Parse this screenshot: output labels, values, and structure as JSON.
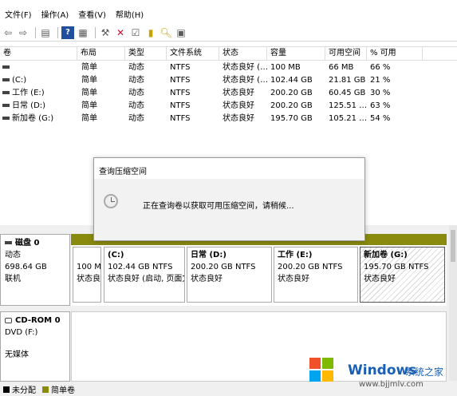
{
  "menu": [
    "文件(F)",
    "操作(A)",
    "查看(V)",
    "帮助(H)"
  ],
  "toolbar_icons": [
    "back-arrow-icon",
    "forward-arrow-icon",
    "panel-icon",
    "help-icon",
    "properties-icon",
    "connect-icon",
    "delete-icon",
    "check-icon",
    "export-icon",
    "search-icon",
    "list-icon"
  ],
  "table": {
    "columns": [
      "卷",
      "布局",
      "类型",
      "文件系统",
      "状态",
      "容量",
      "可用空间",
      "% 可用"
    ],
    "rows": [
      {
        "vol": "",
        "layout": "简单",
        "type": "动态",
        "fs": "NTFS",
        "status": "状态良好 (…",
        "cap": "100 MB",
        "free": "66 MB",
        "pct": "66 %"
      },
      {
        "vol": "(C:)",
        "layout": "简单",
        "type": "动态",
        "fs": "NTFS",
        "status": "状态良好 (…",
        "cap": "102.44 GB",
        "free": "21.81 GB",
        "pct": "21 %"
      },
      {
        "vol": "工作 (E:)",
        "layout": "简单",
        "type": "动态",
        "fs": "NTFS",
        "status": "状态良好",
        "cap": "200.20 GB",
        "free": "60.45 GB",
        "pct": "30 %"
      },
      {
        "vol": "日常 (D:)",
        "layout": "简单",
        "type": "动态",
        "fs": "NTFS",
        "status": "状态良好",
        "cap": "200.20 GB",
        "free": "125.51 …",
        "pct": "63 %"
      },
      {
        "vol": "新加卷 (G:)",
        "layout": "简单",
        "type": "动态",
        "fs": "NTFS",
        "status": "状态良好",
        "cap": "195.70 GB",
        "free": "105.21 …",
        "pct": "54 %"
      }
    ]
  },
  "dialog": {
    "title": "查询压缩空间",
    "message": "正在查询卷以获取可用压缩空间，请稍候..."
  },
  "disk0": {
    "name": "磁盘 0",
    "type": "动态",
    "size": "698.64 GB",
    "state": "联机",
    "partitions": [
      {
        "name": "",
        "size": "100 M",
        "status": "状态良好"
      },
      {
        "name": "(C:)",
        "size": "102.44 GB NTFS",
        "status": "状态良好 (启动, 页面文"
      },
      {
        "name": "日常  (D:)",
        "size": "200.20 GB NTFS",
        "status": "状态良好"
      },
      {
        "name": "工作  (E:)",
        "size": "200.20 GB NTFS",
        "status": "状态良好"
      },
      {
        "name": "新加卷 (G:)",
        "size": "195.70 GB NTFS",
        "status": "状态良好"
      }
    ]
  },
  "cdrom0": {
    "name": "CD-ROM 0",
    "type": "DVD (F:)",
    "state": "无媒体"
  },
  "legend": [
    {
      "label": "未分配",
      "color": "#000000"
    },
    {
      "label": "简单卷",
      "color": "#8a8a0f"
    }
  ],
  "watermark": {
    "brand": "Windows",
    "sub": "系统之家",
    "url": "www.bjjmlv.com"
  }
}
